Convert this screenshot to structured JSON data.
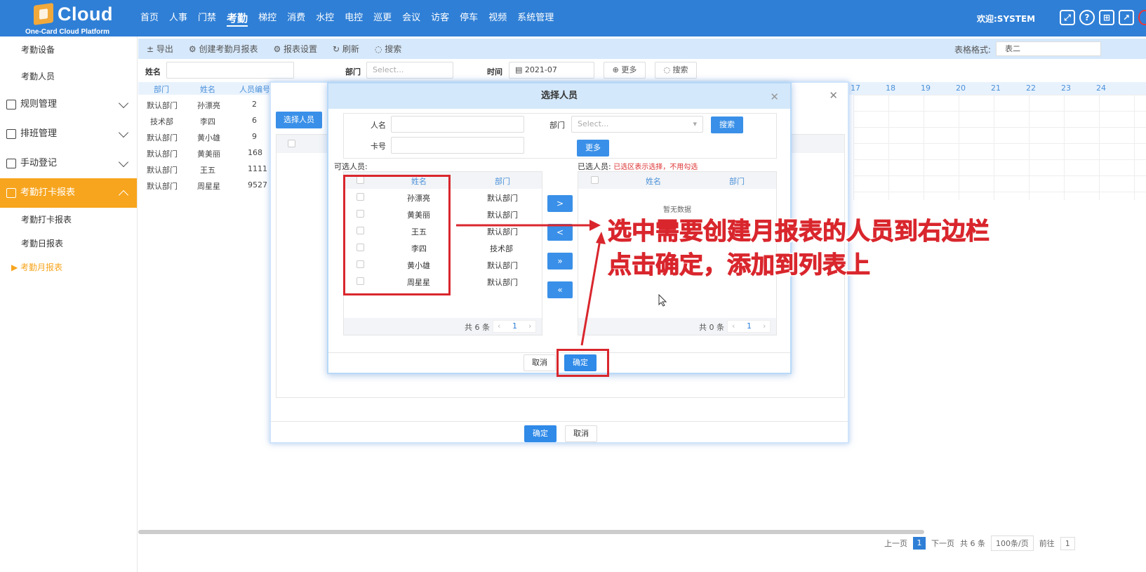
{
  "header": {
    "logo_word": "Cloud",
    "logo_sub": "One-Card Cloud Platform",
    "nav": [
      "首页",
      "人事",
      "门禁",
      "考勤",
      "梯控",
      "消费",
      "水控",
      "电控",
      "巡更",
      "会议",
      "访客",
      "停车",
      "视频",
      "系统管理"
    ],
    "active_nav": "考勤",
    "welcome": "欢迎:SYSTEM",
    "icons": [
      "fullscreen-icon",
      "help-icon",
      "qrcode-icon",
      "external-link-icon",
      "power-icon"
    ]
  },
  "sidebar": {
    "top_items": [
      "考勤设备",
      "考勤人员"
    ],
    "groups": [
      "规则管理",
      "排班管理",
      "手动登记",
      "考勤打卡报表"
    ],
    "sub_items": [
      "考勤打卡报表",
      "考勤日报表",
      "▶ 考勤月报表"
    ]
  },
  "toolbar": {
    "export": "± 导出",
    "create": "⚙ 创建考勤月报表",
    "settings": "⚙ 报表设置",
    "refresh": "↻ 刷新",
    "search": "◌ 搜索",
    "format_label": "表格格式:",
    "format_value": "表二"
  },
  "filter": {
    "name_label": "姓名",
    "dept_label": "部门",
    "dept_placeholder": "Select...",
    "time_label": "时间",
    "time_value": "2021-07",
    "more": "⊕ 更多",
    "search": "◌ 搜索"
  },
  "bg_table": {
    "headers": [
      "部门",
      "姓名",
      "人员编号"
    ],
    "day_headers": [
      "17",
      "18",
      "19",
      "20",
      "21",
      "22",
      "23",
      "24"
    ],
    "rows": [
      [
        "默认部门",
        "孙漂亮",
        "2"
      ],
      [
        "技术部",
        "李四",
        "6"
      ],
      [
        "默认部门",
        "黄小雄",
        "9"
      ],
      [
        "默认部门",
        "黄美丽",
        "168"
      ],
      [
        "默认部门",
        "王五",
        "1111"
      ],
      [
        "默认部门",
        "周星星",
        "9527"
      ]
    ]
  },
  "pager": {
    "prev": "上一页",
    "page": "1",
    "next": "下一页",
    "total": "共 6 条",
    "per_page": "100条/页",
    "goto": "前往",
    "goto_value": "1"
  },
  "outer_modal": {
    "select_btn": "选择人员",
    "ok": "确定",
    "cancel": "取消"
  },
  "inner_modal": {
    "title": "选择人员",
    "name_label": "人名",
    "card_label": "卡号",
    "dept_label": "部门",
    "dept_placeholder": "Select...",
    "search_btn": "搜索",
    "more_btn": "更多",
    "available_label": "可选人员:",
    "selected_label": "已选人员:",
    "selected_note": "已选区表示选择，不用勾选",
    "col_name": "姓名",
    "col_dept": "部门",
    "available": [
      {
        "name": "孙漂亮",
        "dept": "默认部门"
      },
      {
        "name": "黄美丽",
        "dept": "默认部门"
      },
      {
        "name": "王五",
        "dept": "默认部门"
      },
      {
        "name": "李四",
        "dept": "技术部"
      },
      {
        "name": "黄小雄",
        "dept": "默认部门"
      },
      {
        "name": "周星星",
        "dept": "默认部门"
      }
    ],
    "empty_text": "暂无数据",
    "left_total": "共 6 条",
    "right_total": "共 0 条",
    "page": "1",
    "xfer": [
      ">",
      "<",
      "»",
      "«"
    ],
    "cancel": "取消",
    "ok": "确定"
  },
  "annotation": {
    "line1": "选中需要创建月报表的人员到右边栏",
    "line2": "点击确定，添加到列表上",
    "color": "#d9262d"
  }
}
